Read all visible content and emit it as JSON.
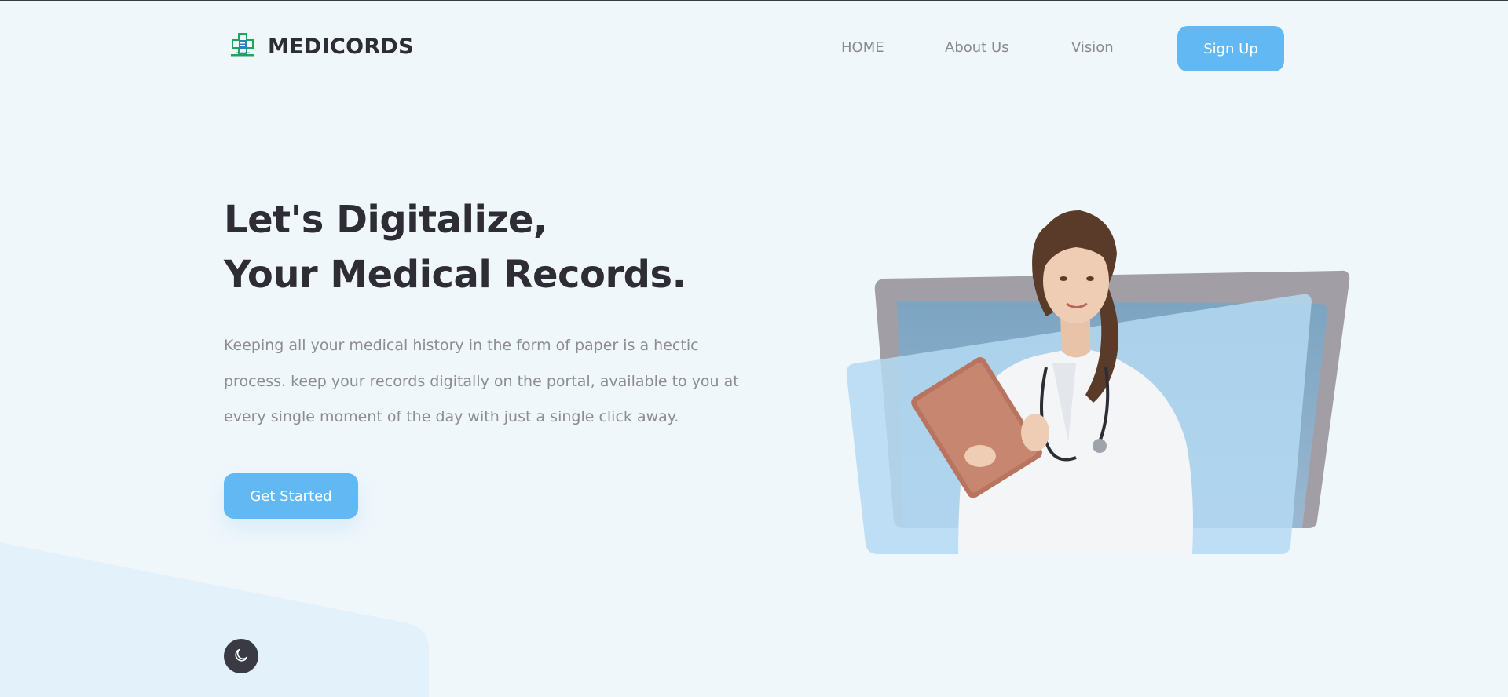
{
  "brand": {
    "name": "MEDICORDS",
    "logo_icon": "medical-cross-logo-icon",
    "logo_text": "MEDICORDS"
  },
  "nav": {
    "items": [
      {
        "label": "HOME"
      },
      {
        "label": "About Us"
      },
      {
        "label": "Vision"
      }
    ],
    "signup_label": "Sign Up"
  },
  "hero": {
    "title_lines": [
      "Let's Digitalize,",
      "Your Medical Records."
    ],
    "description_lines": [
      "Keeping all your medical history in the form of paper is a hectic",
      "process. keep your records digitally on the portal, available to you at",
      "every single moment of the day with just a single click away."
    ],
    "cta_label": "Get Started",
    "image": "doctor-holding-tablet-illustration"
  },
  "theme_toggle": {
    "icon": "moon-icon"
  },
  "colors": {
    "accent": "#62b8f2",
    "heading": "#2e2d36",
    "body_text": "#8d8b93",
    "background": "#f0f7fb",
    "card_gray": "#a19ea6",
    "card_blue": "#b4d9f2"
  }
}
